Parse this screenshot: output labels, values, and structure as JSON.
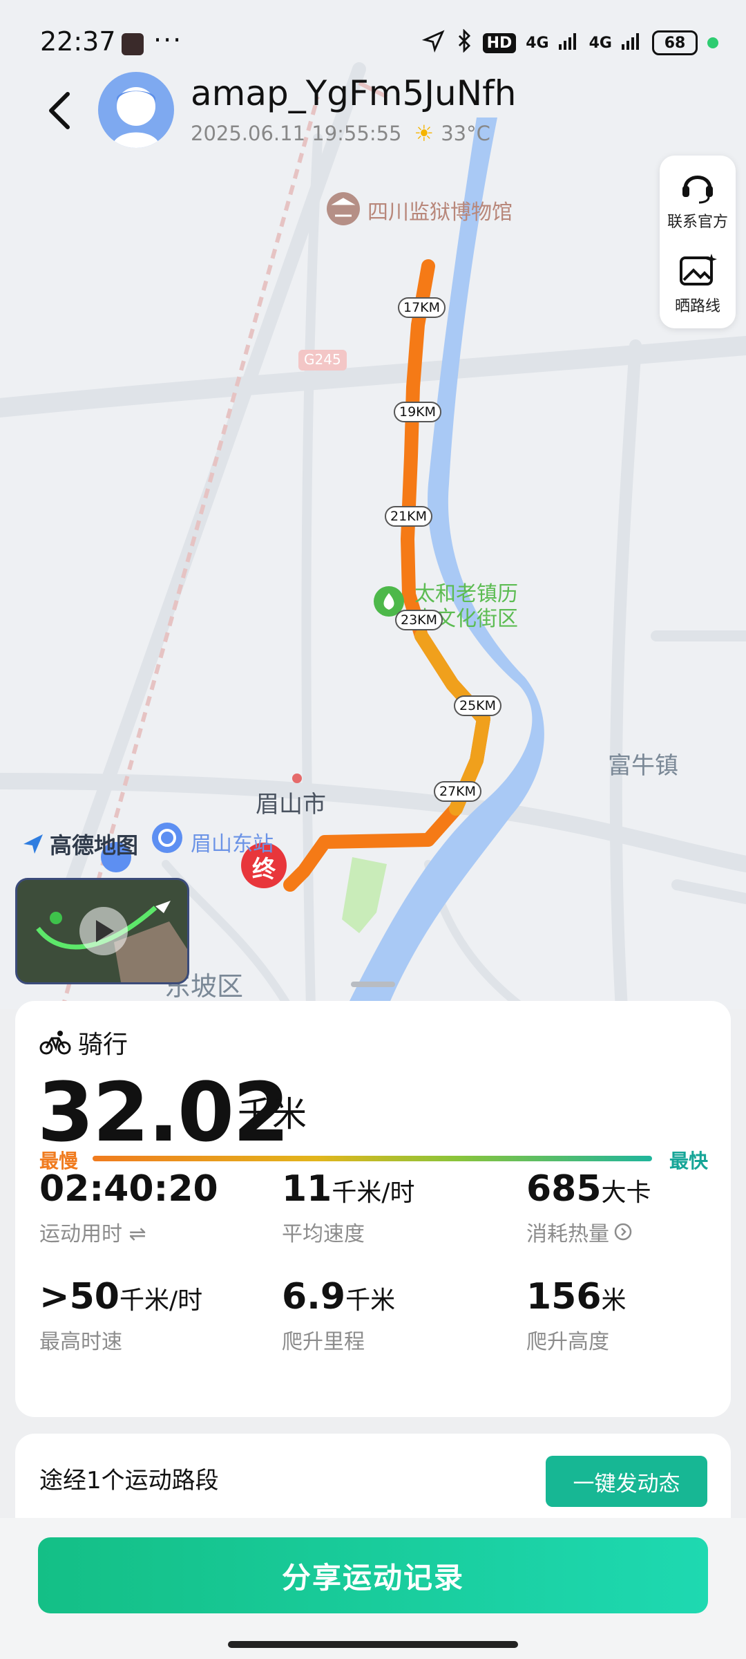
{
  "status": {
    "time": "22:37",
    "dots": "···",
    "hd": "HD",
    "net1": "4G",
    "net2": "4G",
    "battery": "68"
  },
  "header": {
    "username": "amap_YgFm5JuNfh",
    "datetime": "2025.06.11 19:55:55",
    "temperature": "33°C"
  },
  "side_panel": {
    "contact_label": "联系官方",
    "share_route_label": "晒路线"
  },
  "map": {
    "poi_museum": "四川监狱博物馆",
    "road_badge": "G245",
    "poi_street_1": "太和老镇历",
    "poi_street_2": "史文化街区",
    "town_funiu": "富牛镇",
    "city_meishan": "眉山市",
    "station": "眉山东站",
    "district": "东坡区",
    "logo": "高德地图",
    "end_marker": "终",
    "km_markers": [
      "17KM",
      "19KM",
      "21KM",
      "23KM",
      "25KM",
      "27KM"
    ]
  },
  "summary": {
    "sport_type": "骑行",
    "distance": "32.02",
    "distance_unit": "千米",
    "slowest": "最慢",
    "fastest": "最快"
  },
  "stats": [
    {
      "value": "02:40:20",
      "unit": "",
      "label": "运动用时 ⇌"
    },
    {
      "value": "11",
      "unit": "千米/时",
      "label": "平均速度"
    },
    {
      "value": "685",
      "unit": "大卡",
      "label": "消耗热量"
    },
    {
      "value": ">50",
      "unit": "千米/时",
      "label": "最高时速"
    },
    {
      "value": "6.9",
      "unit": "千米",
      "label": "爬升里程"
    },
    {
      "value": "156",
      "unit": "米",
      "label": "爬升高度"
    }
  ],
  "segments": {
    "title": "途经1个运动路段",
    "post_button": "一键发动态"
  },
  "share_button": "分享运动记录"
}
